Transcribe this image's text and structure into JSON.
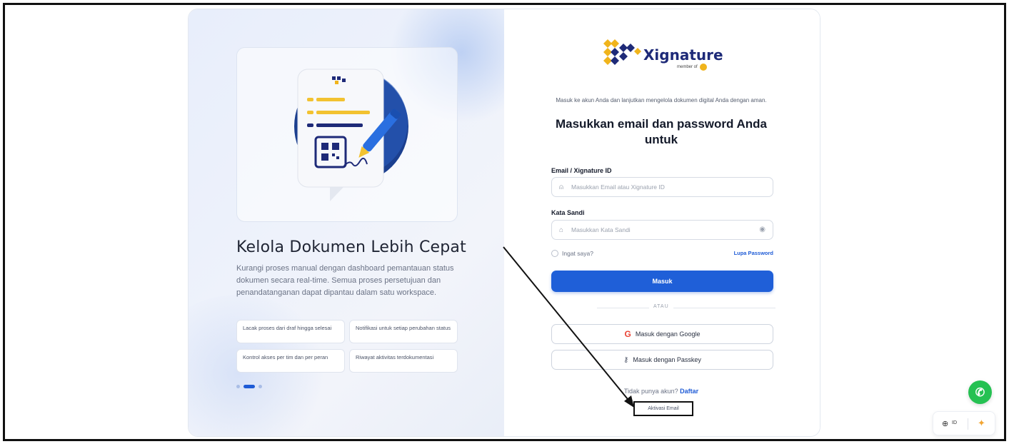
{
  "left_panel": {
    "title": "Kelola Dokumen Lebih Cepat",
    "description": "Kurangi proses manual dengan dashboard pemantauan status dokumen secara real-time. Semua proses persetujuan dan penandatanganan dapat dipantau dalam satu workspace.",
    "features": [
      "Lacak proses dari draf hingga selesai",
      "Notifikasi untuk setiap perubahan status",
      "Kontrol akses per tim dan per peran",
      "Riwayat aktivitas terdokumentasi"
    ],
    "carousel": {
      "count": 3,
      "active": 2
    }
  },
  "brand": {
    "name": "Xignature",
    "member_of": "member of"
  },
  "form": {
    "intro": "Masuk ke akun Anda dan lanjutkan mengelola dokumen digital Anda dengan aman.",
    "heading": "Masukkan email dan password Anda untuk",
    "email_label": "Email / Xignature ID",
    "email_placeholder": "Masukkan Email atau Xignature ID",
    "password_label": "Kata Sandi",
    "password_placeholder": "Masukkan Kata Sandi",
    "remember_label": "Ingat saya?",
    "forgot_label": "Lupa Password",
    "login_button": "Masuk",
    "divider": "ATAU",
    "google_button": "Masuk dengan Google",
    "passkey_button": "Masuk dengan Passkey",
    "no_account": "Tidak punya akun?",
    "signup_link": "Daftar",
    "activate_email": "Aktivasi Email"
  },
  "widgets": {
    "language_code": "ID"
  },
  "colors": {
    "primary": "#1f5fd8",
    "brand_navy": "#1e2a78",
    "brand_gold": "#f0b41c",
    "whatsapp": "#25c152"
  }
}
